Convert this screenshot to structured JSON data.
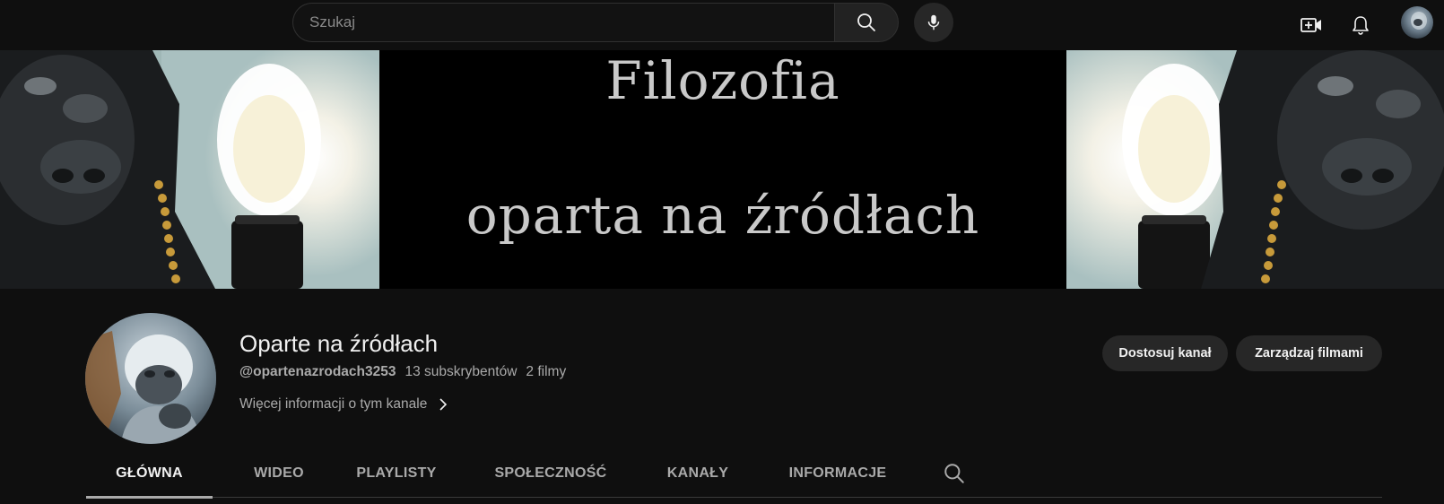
{
  "topbar": {
    "search_placeholder": "Szukaj",
    "icons": [
      "search-icon",
      "mic-icon",
      "create-video-icon",
      "bell-icon",
      "account-avatar"
    ]
  },
  "banner": {
    "line1": "Filozofia",
    "line2": "oparta na źródłach"
  },
  "channel": {
    "name": "Oparte na źródłach",
    "handle": "@opartenazrodach3253",
    "subscribers": "13 subskrybentów",
    "videos": "2 filmy",
    "more_info": "Więcej informacji o tym kanale"
  },
  "actions": {
    "customize": "Dostosuj kanał",
    "manage": "Zarządzaj filmami"
  },
  "tabs": [
    {
      "label": "GŁÓWNA",
      "active": true
    },
    {
      "label": "WIDEO",
      "active": false
    },
    {
      "label": "PLAYLISTY",
      "active": false
    },
    {
      "label": "SPOŁECZNOŚĆ",
      "active": false
    },
    {
      "label": "KANAŁY",
      "active": false
    },
    {
      "label": "INFORMACJE",
      "active": false
    }
  ],
  "colors": {
    "background": "#0f0f0f",
    "button": "#272727",
    "text_primary": "#f1f1f1",
    "text_secondary": "#aaaaaa"
  }
}
